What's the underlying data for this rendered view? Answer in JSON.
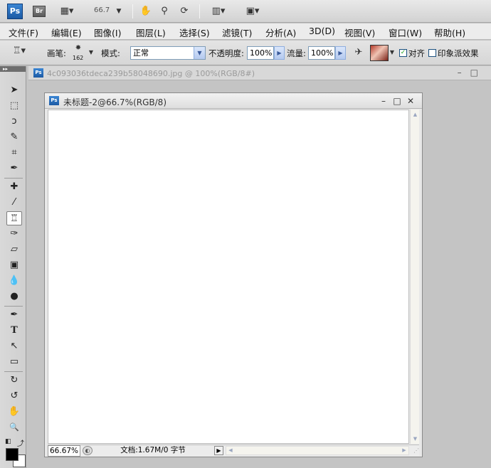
{
  "appbar": {
    "ps_logo": "Ps",
    "bridge_logo": "Br",
    "zoom": "66.7",
    "icons": [
      "view-extras-icon",
      "zoom-level-dropdown",
      "hand-icon",
      "zoom-icon",
      "rotate-view-icon",
      "arrange-documents-icon",
      "screen-mode-icon"
    ]
  },
  "menu": {
    "items": [
      "文件(F)",
      "编辑(E)",
      "图像(I)",
      "图层(L)",
      "选择(S)",
      "滤镜(T)",
      "分析(A)",
      "3D(D)",
      "视图(V)",
      "窗口(W)",
      "帮助(H)"
    ]
  },
  "options": {
    "brush_label": "画笔:",
    "brush_size": "162",
    "mode_label": "模式:",
    "mode_value": "正常",
    "opacity_label": "不透明度:",
    "opacity_value": "100%",
    "flow_label": "流量:",
    "flow_value": "100%",
    "aligned_label": "对齐",
    "aligned_checked": true,
    "impressionist_label": "印象派效果",
    "impressionist_checked": false
  },
  "tools": {
    "header": "▸▸",
    "items": [
      {
        "name": "move-tool-icon",
        "glyph": "➤"
      },
      {
        "name": "marquee-tool-icon",
        "glyph": "⬚"
      },
      {
        "name": "lasso-tool-icon",
        "glyph": "ↄ"
      },
      {
        "name": "quick-selection-tool-icon",
        "glyph": "✎"
      },
      {
        "name": "crop-tool-icon",
        "glyph": "⌗"
      },
      {
        "name": "eyedropper-tool-icon",
        "glyph": "✒"
      },
      {
        "name": "healing-brush-tool-icon",
        "glyph": "✚"
      },
      {
        "name": "brush-tool-icon",
        "glyph": "⁄"
      },
      {
        "name": "clone-stamp-tool-icon",
        "glyph": "♖"
      },
      {
        "name": "history-brush-tool-icon",
        "glyph": "✑"
      },
      {
        "name": "eraser-tool-icon",
        "glyph": "▱"
      },
      {
        "name": "gradient-tool-icon",
        "glyph": "▣"
      },
      {
        "name": "blur-tool-icon",
        "glyph": "💧"
      },
      {
        "name": "dodge-tool-icon",
        "glyph": "●"
      },
      {
        "name": "pen-tool-icon",
        "glyph": "✒"
      },
      {
        "name": "type-tool-icon",
        "glyph": "T"
      },
      {
        "name": "path-selection-tool-icon",
        "glyph": "↖"
      },
      {
        "name": "shape-tool-icon",
        "glyph": "▭"
      },
      {
        "name": "3d-rotate-tool-icon",
        "glyph": "↻"
      },
      {
        "name": "3d-orbit-tool-icon",
        "glyph": "↺"
      },
      {
        "name": "hand-tool-icon",
        "glyph": "✋"
      },
      {
        "name": "zoom-tool-icon",
        "glyph": "🔍"
      }
    ]
  },
  "background_document": {
    "title": "4c093036tdeca239b58048690.jpg @ 100%(RGB/8#)"
  },
  "document": {
    "title": "未标题-2@66.7%(RGB/8)",
    "zoom": "66.67%",
    "status": "文档:1.67M/0 字节"
  },
  "colors": {
    "foreground": "#000000",
    "background": "#ffffff",
    "accent": "#1c5aa4"
  }
}
